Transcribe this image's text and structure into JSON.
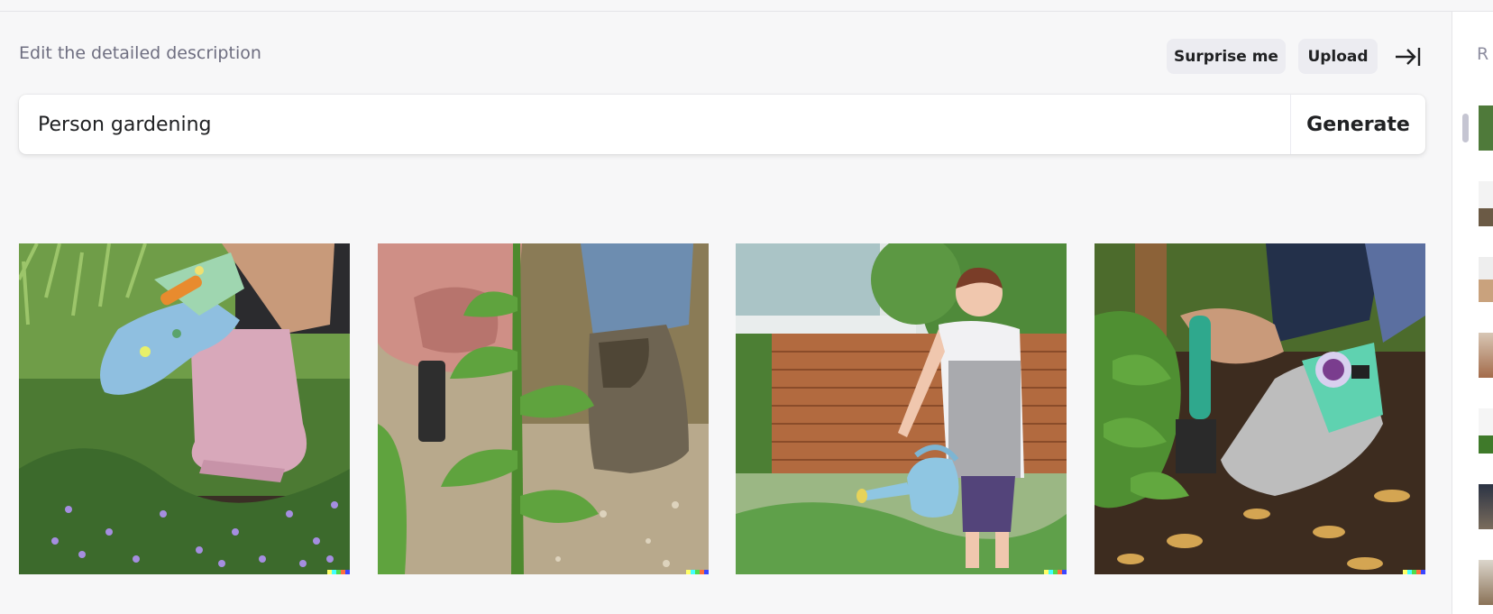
{
  "header": {
    "description_label": "Edit the detailed description",
    "surprise_label": "Surprise me",
    "upload_label": "Upload"
  },
  "prompt": {
    "value": "Person gardening",
    "generate_label": "Generate"
  },
  "results": [
    {
      "subject": "gloved hand pulling weeds beside pink rubber boots"
    },
    {
      "subject": "hand gripping a plant stem next to a worn boot"
    },
    {
      "subject": "woman watering vegetable bed with blue watering can"
    },
    {
      "subject": "gloved hand digging soil with a green trowel"
    }
  ],
  "sidebar": {
    "heading": "R",
    "history_count": 7
  },
  "colors": {
    "background": "#f7f7f8",
    "accent_signature": [
      "#ffff66",
      "#42ffff",
      "#51da4c",
      "#ff6e3c",
      "#3c46ff"
    ]
  }
}
